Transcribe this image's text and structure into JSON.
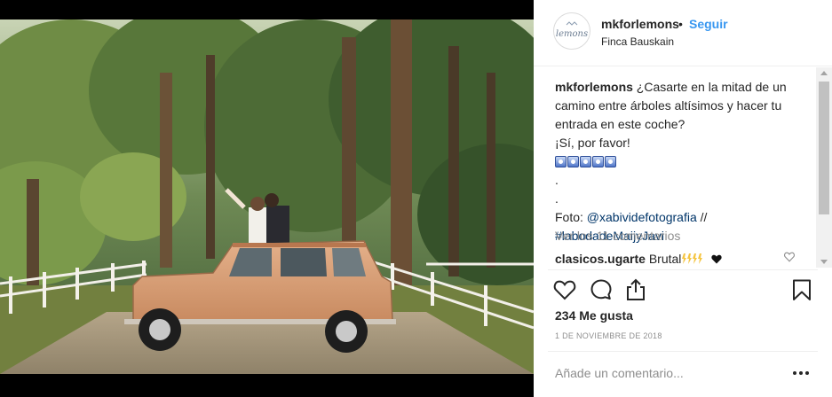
{
  "header": {
    "username": "mkforlemons",
    "separator": "•",
    "follow_label": "Seguir",
    "location": "Finca Bauskain",
    "avatar_text": "lemons",
    "avatar_accent": "#8a9bb0"
  },
  "caption": {
    "username": "mkforlemons",
    "text": " ¿Casarte en la mitad de un camino entre árboles altísimos y hacer tu entrada en este coche?",
    "line2": "¡Sí, por favor!",
    "emoji_icon": "smiling-face-emoji-icon",
    "dot1": ".",
    "dot2": ".",
    "credit_prefix": "Foto: ",
    "credit_handle": "@xabividefotografia",
    "credit_suffix": " //",
    "hashtag": "#labodadeMaijyJavi"
  },
  "view_all_comments": "Ver los 11 comentarios",
  "comment": {
    "username": "clasicos.ugarte",
    "text": " Brutal",
    "emoji_icons": [
      "high-voltage-icon",
      "high-voltage-icon",
      "high-voltage-icon",
      "high-voltage-icon",
      "black-heart-icon"
    ]
  },
  "actions": {
    "like_icon": "heart-outline-icon",
    "comment_icon": "comment-bubble-icon",
    "share_icon": "share-upload-icon",
    "save_icon": "bookmark-icon"
  },
  "likes": "234 Me gusta",
  "date": "1 de noviembre de 2018",
  "add_comment_placeholder": "Añade un comentario...",
  "more_icon": "ellipsis-icon",
  "colors": {
    "link_blue": "#3897f0",
    "hashtag_blue": "#003569",
    "muted": "#8e8e8e",
    "text": "#262626",
    "car": "#d79b72"
  }
}
